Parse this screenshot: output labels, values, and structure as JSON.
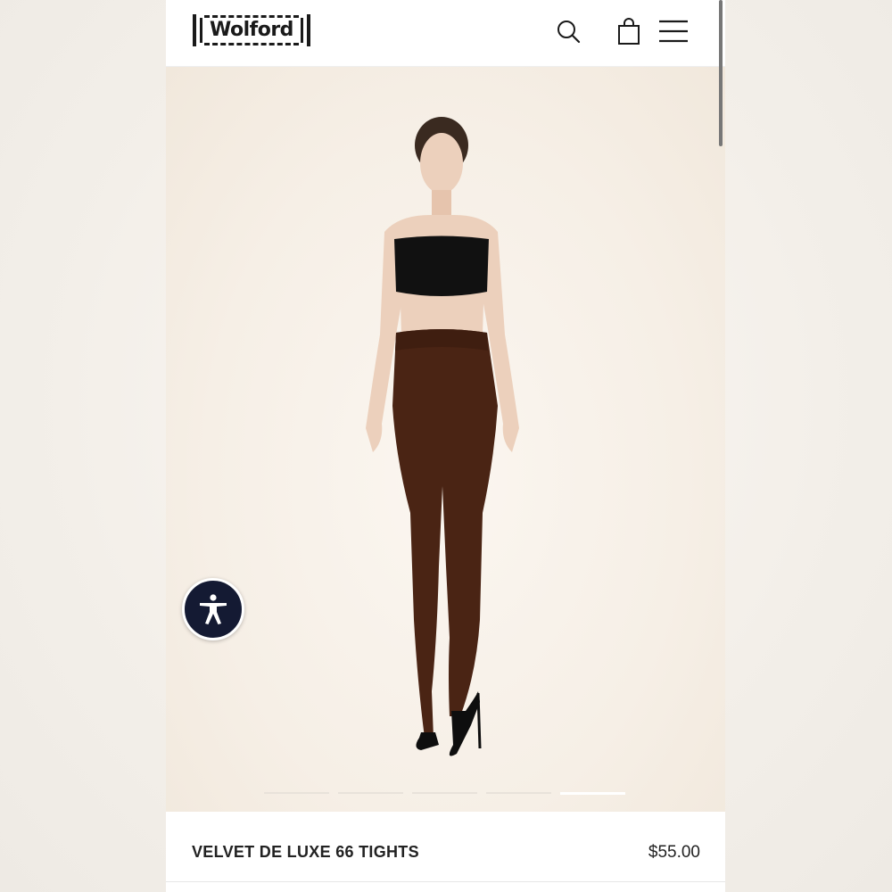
{
  "header": {
    "logo_text": "Wolford",
    "icons": [
      "search-icon",
      "shopping-bag-icon",
      "hamburger-menu-icon"
    ]
  },
  "hero": {
    "carousel": {
      "total": 5,
      "active_index": 4
    },
    "colors": {
      "tights": "#4a2414",
      "top": "#111111",
      "skin": "#e8c8b0"
    }
  },
  "accessibility": {
    "icon": "accessibility-person-icon",
    "color": "#141a33"
  },
  "product": {
    "name": "VELVET DE LUXE 66 TIGHTS",
    "price": "$55.00"
  }
}
